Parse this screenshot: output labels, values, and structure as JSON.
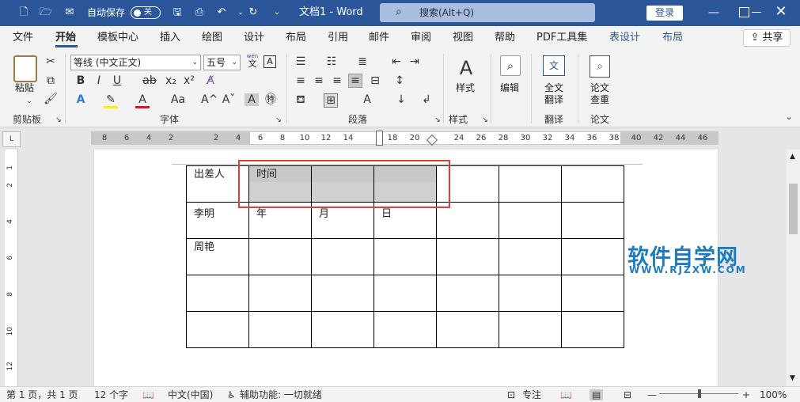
{
  "titlebar": {
    "autosave_label": "自动保存",
    "autosave_state": "关",
    "doc_title": "文档1 - Word",
    "search_placeholder": "搜索(Alt+Q)",
    "login_label": "登录",
    "minimize_icon": "minimize-icon",
    "maximize_icon": "maximize-icon",
    "close_icon": "close-icon"
  },
  "tabs": [
    "文件",
    "开始",
    "模板中心",
    "插入",
    "绘图",
    "设计",
    "布局",
    "引用",
    "邮件",
    "审阅",
    "视图",
    "帮助",
    "PDF工具集",
    "表设计",
    "布局"
  ],
  "share_label": "共享",
  "ribbon": {
    "clipboard": {
      "paste": "粘贴",
      "group": "剪贴板"
    },
    "font": {
      "font_name": "等线 (中文正文)",
      "font_size": "五号",
      "wen": "wén",
      "wen_char": "文",
      "group": "字体"
    },
    "paragraph": {
      "group": "段落"
    },
    "styles": {
      "label": "样式",
      "group": "样式"
    },
    "editing": {
      "label": "编辑"
    },
    "translate": {
      "label1": "全文",
      "label2": "翻译",
      "group": "翻译"
    },
    "paper": {
      "label1": "论文",
      "label2": "查重",
      "group": "论文"
    }
  },
  "ruler": {
    "ticks": [
      "8",
      "6",
      "4",
      "2",
      "2",
      "4",
      "6",
      "8",
      "10",
      "12",
      "14",
      "18",
      "20",
      "24",
      "26",
      "28",
      "30",
      "32",
      "34",
      "36",
      "38",
      "40",
      "42",
      "44",
      "46"
    ]
  },
  "vruler_ticks": [
    "1",
    "2",
    "1",
    "4",
    "1",
    "6",
    "1",
    "8",
    "1",
    "10",
    "1",
    "12"
  ],
  "table": {
    "rows": [
      [
        "出差人",
        "时间",
        "",
        "",
        "",
        "",
        ""
      ],
      [
        "李明",
        "年",
        "月",
        "日",
        "",
        "",
        ""
      ],
      [
        "周艳",
        "",
        "",
        "",
        "",
        "",
        ""
      ],
      [
        "",
        "",
        "",
        "",
        "",
        "",
        ""
      ],
      [
        "",
        "",
        "",
        "",
        "",
        "",
        ""
      ]
    ]
  },
  "watermark": {
    "title": "软件自学网",
    "url": "WWW.RJZXW.COM"
  },
  "statusbar": {
    "page": "第 1 页，共 1 页",
    "words": "12 个字",
    "language": "中文(中国)",
    "accessibility": "辅助功能: 一切就绪",
    "focus": "专注",
    "zoom": "100%"
  }
}
